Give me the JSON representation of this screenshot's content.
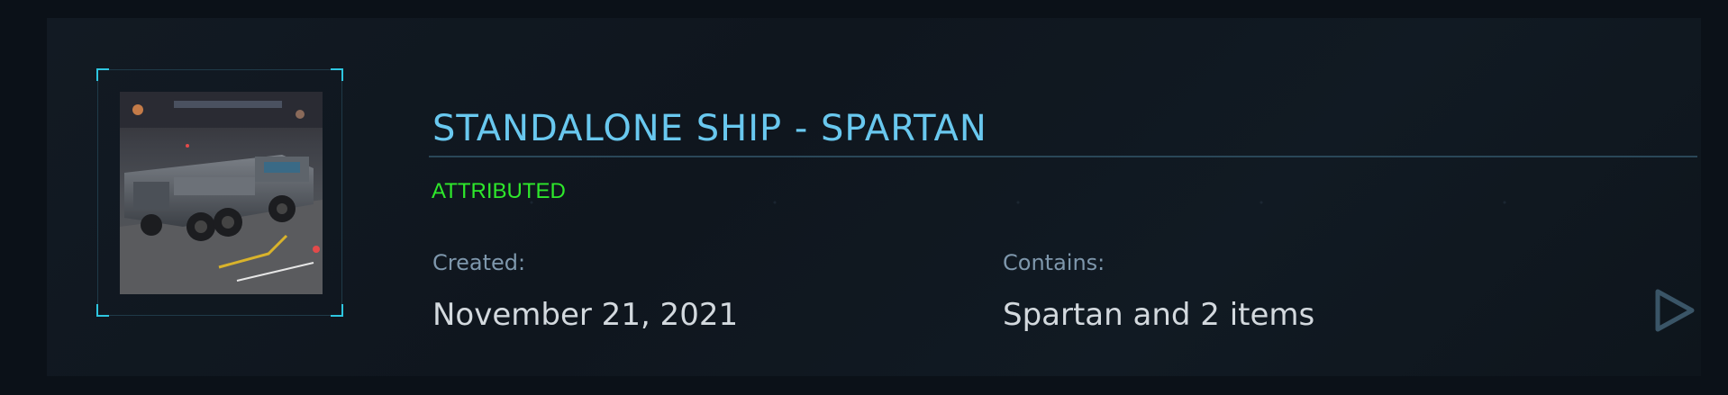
{
  "card": {
    "title": "STANDALONE SHIP - SPARTAN",
    "status": "ATTRIBUTED",
    "created_label": "Created:",
    "created_value": "November 21, 2021",
    "contains_label": "Contains:",
    "contains_value": "Spartan and 2 items"
  },
  "colors": {
    "title": "#69c8ef",
    "status": "#2ee82b",
    "label": "#7e97ac",
    "value": "#d3d9de",
    "accent": "#2ec6e0"
  },
  "icons": {
    "thumbnail": "ship-thumbnail-image",
    "action": "play-triangle-icon"
  }
}
